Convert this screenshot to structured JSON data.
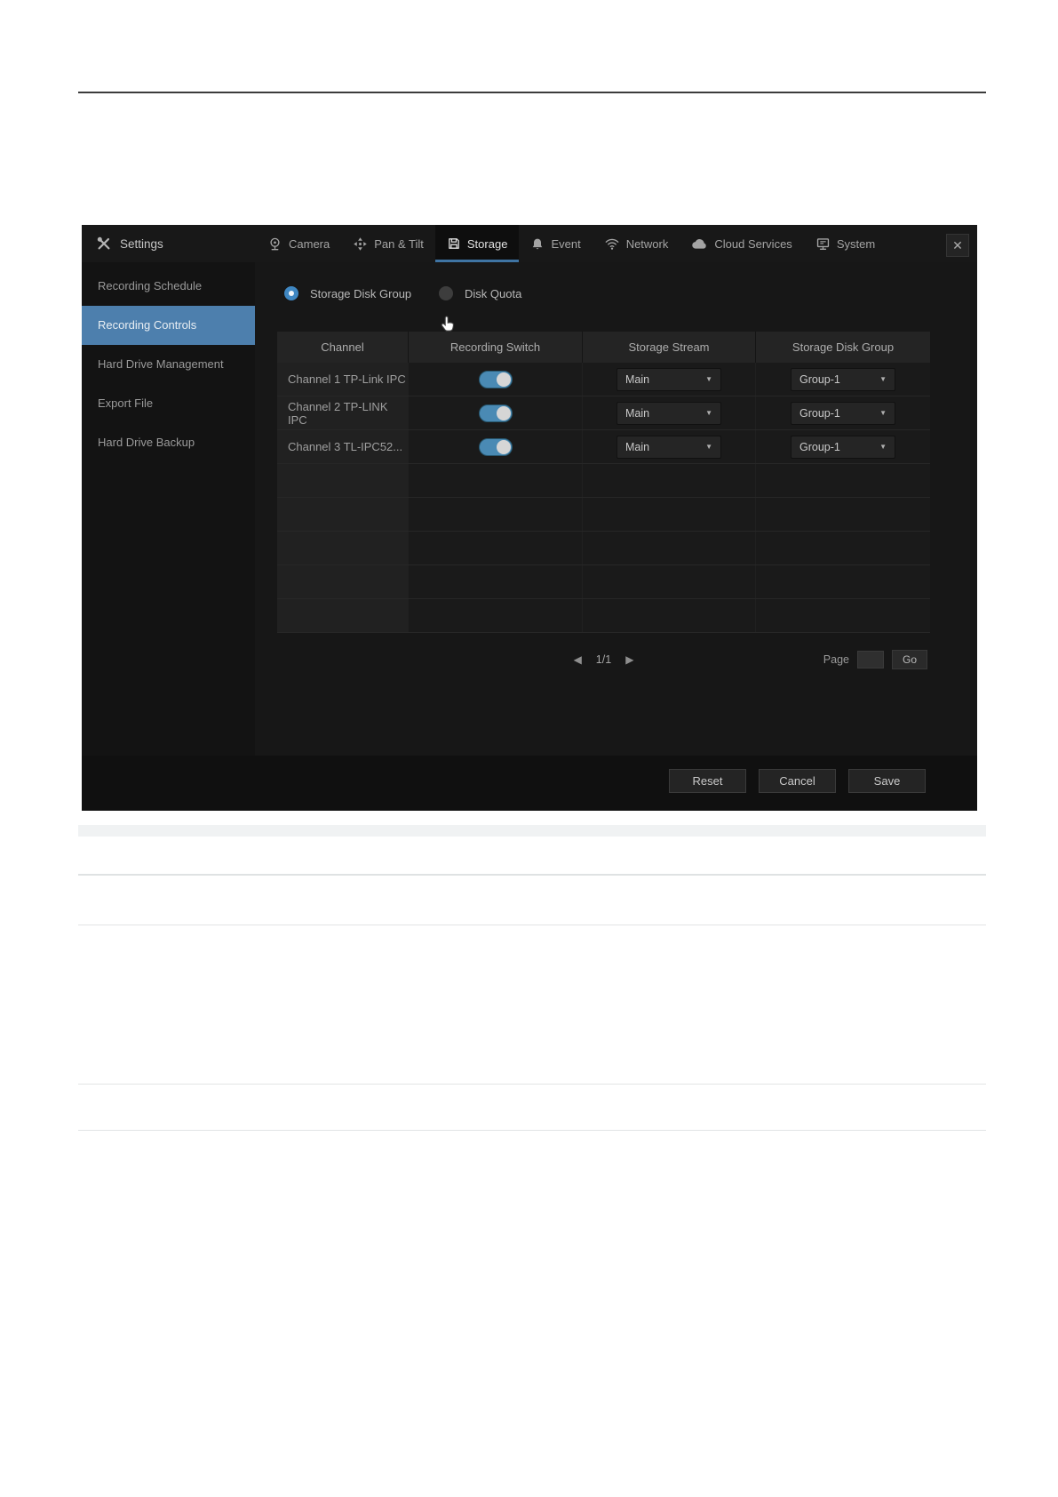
{
  "window": {
    "title": "Settings",
    "close_glyph": "✕",
    "tabs": [
      {
        "label": "Camera",
        "icon": "camera-icon",
        "active": false
      },
      {
        "label": "Pan & Tilt",
        "icon": "pan-tilt-icon",
        "active": false
      },
      {
        "label": "Storage",
        "icon": "storage-icon",
        "active": true
      },
      {
        "label": "Event",
        "icon": "bell-icon",
        "active": false
      },
      {
        "label": "Network",
        "icon": "network-icon",
        "active": false
      },
      {
        "label": "Cloud Services",
        "icon": "cloud-icon",
        "active": false
      },
      {
        "label": "System",
        "icon": "system-icon",
        "active": false
      }
    ]
  },
  "sidebar": {
    "items": [
      {
        "label": "Recording Schedule",
        "selected": false
      },
      {
        "label": "Recording Controls",
        "selected": true
      },
      {
        "label": "Hard Drive Management",
        "selected": false
      },
      {
        "label": "Export File",
        "selected": false
      },
      {
        "label": "Hard Drive Backup",
        "selected": false
      }
    ]
  },
  "options": {
    "storage_disk_group": {
      "label": "Storage Disk Group",
      "selected": true
    },
    "disk_quota": {
      "label": "Disk Quota",
      "selected": false
    }
  },
  "table": {
    "columns": [
      "Channel",
      "Recording Switch",
      "Storage Stream",
      "Storage Disk Group"
    ],
    "rows": [
      {
        "channel": "Channel 1 TP-Link IPC",
        "recording_switch": true,
        "storage_stream": "Main",
        "storage_disk_group": "Group-1"
      },
      {
        "channel": "Channel 2 TP-LINK IPC",
        "recording_switch": true,
        "storage_stream": "Main",
        "storage_disk_group": "Group-1"
      },
      {
        "channel": "Channel 3 TL-IPC52...",
        "recording_switch": true,
        "storage_stream": "Main",
        "storage_disk_group": "Group-1"
      }
    ],
    "empty_row_count": 5
  },
  "pagination": {
    "prev_glyph": "◀",
    "current": "1/1",
    "next_glyph": "▶",
    "page_label": "Page",
    "page_input_value": "",
    "go_label": "Go"
  },
  "footer": {
    "buttons": [
      {
        "label": "Reset"
      },
      {
        "label": "Cancel"
      },
      {
        "label": "Save"
      }
    ]
  },
  "colors": {
    "sidebar_selected": "#4d7fad",
    "tab_underline": "#3f74a3",
    "toggle_on": "#4a8ab4",
    "radio_on": "#3f87c2"
  }
}
